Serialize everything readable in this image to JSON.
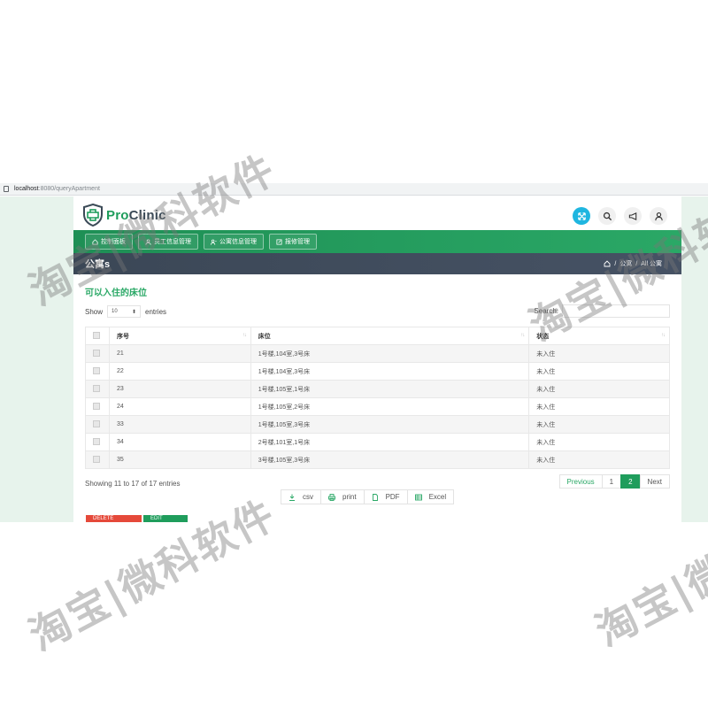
{
  "browser": {
    "url_host": "localhost",
    "url_rest": ":8080/queryApartment"
  },
  "brand": {
    "pro": "Pro",
    "clinic": "Clinic"
  },
  "header_icons": [
    "expand-icon",
    "search-icon",
    "megaphone-icon",
    "user-icon"
  ],
  "nav": [
    {
      "label": "控制面板",
      "icon": "home-icon"
    },
    {
      "label": "员工信息管理",
      "icon": "user-icon"
    },
    {
      "label": "公寓信息管理",
      "icon": "users-icon"
    },
    {
      "label": "报修管理",
      "icon": "edit-icon"
    }
  ],
  "page": {
    "title": "公寓s",
    "breadcrumb": [
      "公寓",
      "All 公寓"
    ]
  },
  "section_title": "可以入住的床位",
  "show": {
    "before": "Show",
    "value": "10",
    "after": "entries"
  },
  "search": {
    "label": "Search:",
    "value": ""
  },
  "table": {
    "columns": [
      "",
      "序号",
      "床位",
      "状态"
    ],
    "rows": [
      {
        "id": "21",
        "bed": "1号楼,104室,3号床",
        "status": "未入住"
      },
      {
        "id": "22",
        "bed": "1号楼,104室,3号床",
        "status": "未入住"
      },
      {
        "id": "23",
        "bed": "1号楼,105室,1号床",
        "status": "未入住"
      },
      {
        "id": "24",
        "bed": "1号楼,105室,2号床",
        "status": "未入住"
      },
      {
        "id": "33",
        "bed": "1号楼,105室,3号床",
        "status": "未入住"
      },
      {
        "id": "34",
        "bed": "2号楼,101室,1号床",
        "status": "未入住"
      },
      {
        "id": "35",
        "bed": "3号楼,105室,3号床",
        "status": "未入住"
      }
    ]
  },
  "info": "Showing 11 to 17 of 17 entries",
  "pagination": {
    "prev": "Previous",
    "pages": [
      "1",
      "2"
    ],
    "active": "2",
    "next": "Next"
  },
  "export": [
    {
      "label": "csv",
      "icon": "download-icon"
    },
    {
      "label": "print",
      "icon": "printer-icon"
    },
    {
      "label": "PDF",
      "icon": "file-icon"
    },
    {
      "label": "Excel",
      "icon": "table-icon"
    }
  ],
  "actions": {
    "delete": "DELETE",
    "edit": "EDIT"
  },
  "watermark": "淘宝|微科软件",
  "colors": {
    "primary_green": "#1f9d5c",
    "title_bar": "#3b4756",
    "accent_blue": "#1fb6e0",
    "delete_red": "#e5493a"
  }
}
